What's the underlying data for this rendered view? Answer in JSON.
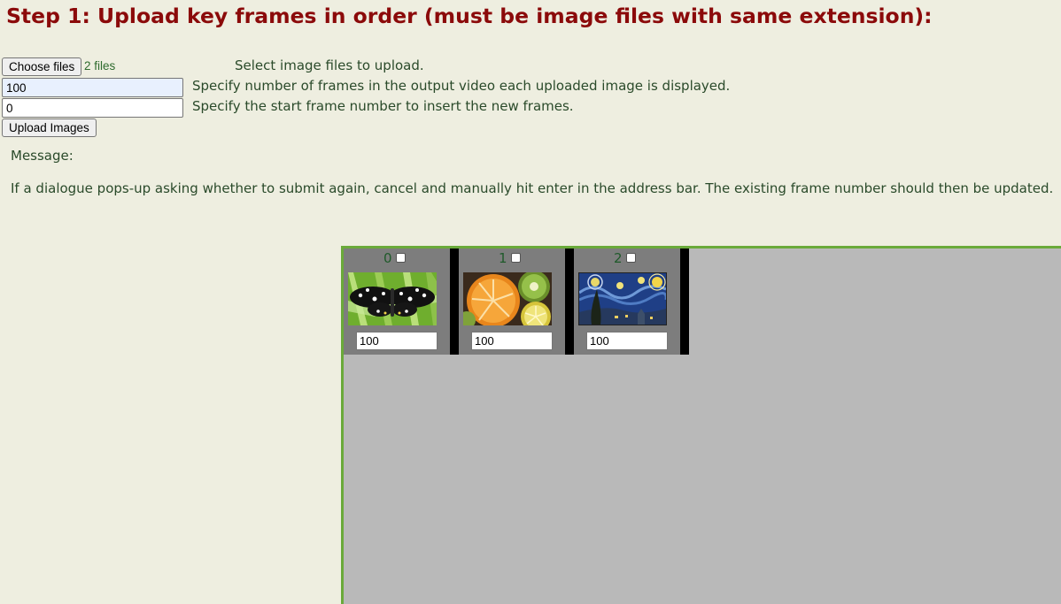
{
  "heading": "Step 1: Upload key frames in order (must be image files with same extension):",
  "upload": {
    "choose_label": "Choose files",
    "file_status": "2 files",
    "choose_help": "Select image files to upload.",
    "frames_value": "100",
    "frames_help": "Specify number of frames in the output video each uploaded image is displayed.",
    "start_value": "0",
    "start_help": "Specify the start frame number to insert the new frames.",
    "submit_label": "Upload Images"
  },
  "message": {
    "label": "Message:",
    "note": "If a dialogue pops-up asking whether to submit again, cancel and manually hit enter in the address bar. The existing frame number should then be updated."
  },
  "frames": [
    {
      "index": "0",
      "duration": "100",
      "thumbnail": "butterfly-image"
    },
    {
      "index": "1",
      "duration": "100",
      "thumbnail": "citrus-fruit-image"
    },
    {
      "index": "2",
      "duration": "100",
      "thumbnail": "starry-night-painting-image"
    }
  ],
  "colors": {
    "background": "#eeeee0",
    "heading": "#8b0a0a",
    "text": "#2a4a2a",
    "panel": "#b9b9b9",
    "panel_border": "#6aaa3a",
    "card": "#7d7d7d"
  }
}
